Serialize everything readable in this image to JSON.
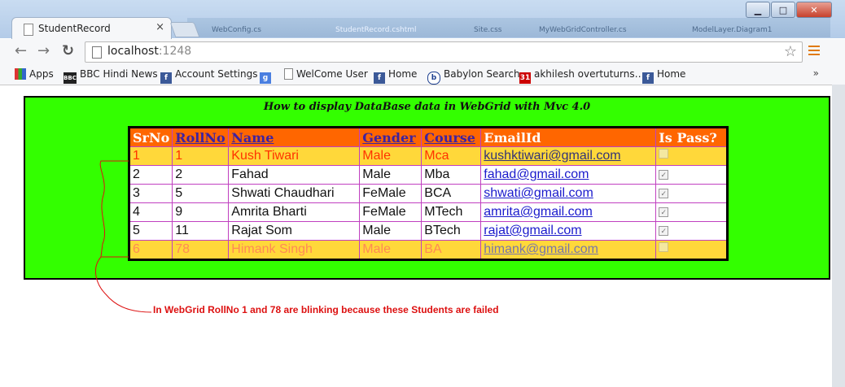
{
  "browser": {
    "tab_title": "StudentRecord",
    "tab_close": "×",
    "url_host": "localhost",
    "url_port": ":1248",
    "window_controls": {
      "minimize": "▁",
      "maximize": "□",
      "close": "✕"
    },
    "background_tabs": [
      "WebConfig.cs",
      "StudentRecord.cshtml",
      "Site.css",
      "MyWebGridController.cs",
      "ModelLayer.Diagram1"
    ]
  },
  "bookmarks": [
    {
      "label": "Apps",
      "icon": "apps-grid-icon"
    },
    {
      "label": "BBC Hindi News",
      "icon": "bbc-icon"
    },
    {
      "label": "Account Settings",
      "icon": "facebook-icon"
    },
    {
      "label": "",
      "icon": "google-icon"
    },
    {
      "label": "WelCome User",
      "icon": "page-icon"
    },
    {
      "label": "Home",
      "icon": "facebook-icon"
    },
    {
      "label": "Babylon Search",
      "icon": "babylon-icon"
    },
    {
      "label": "akhilesh overtuturns…",
      "icon": "news-icon"
    },
    {
      "label": "Home",
      "icon": "facebook-icon"
    }
  ],
  "bookmarks_more": "»",
  "page": {
    "heading": "How to display DataBase data in WebGrid with Mvc 4.0",
    "columns": [
      {
        "label": "SrNo",
        "sortable": false
      },
      {
        "label": "RollNo",
        "sortable": true
      },
      {
        "label": "Name",
        "sortable": true
      },
      {
        "label": "Gender",
        "sortable": true
      },
      {
        "label": "Course",
        "sortable": true
      },
      {
        "label": "EmailId",
        "sortable": false
      },
      {
        "label": "Is Pass?",
        "sortable": false
      }
    ],
    "rows": [
      {
        "srno": "1",
        "rollno": "1",
        "name": "Kush Tiwari",
        "gender": "Male",
        "course": "Mca",
        "email": "kushktiwari@gmail.com",
        "pass": false
      },
      {
        "srno": "2",
        "rollno": "2",
        "name": "Fahad",
        "gender": "Male",
        "course": "Mba",
        "email": "fahad@gmail.com",
        "pass": true
      },
      {
        "srno": "3",
        "rollno": "5",
        "name": "Shwati Chaudhari",
        "gender": "FeMale",
        "course": "BCA",
        "email": "shwati@gmail.com",
        "pass": true
      },
      {
        "srno": "4",
        "rollno": "9",
        "name": "Amrita Bharti",
        "gender": "FeMale",
        "course": "MTech",
        "email": "amrita@gmail.com",
        "pass": true
      },
      {
        "srno": "5",
        "rollno": "11",
        "name": "Rajat Som",
        "gender": "Male",
        "course": "BTech",
        "email": "rajat@gmail.com",
        "pass": true
      },
      {
        "srno": "6",
        "rollno": "78",
        "name": "Himank Singh",
        "gender": "Male",
        "course": "BA",
        "email": "himank@gmail.com",
        "pass": false
      }
    ],
    "annotation": "In WebGrid RollNo 1 and  78 are blinking because these Students are failed"
  },
  "colors": {
    "panel_bg": "#33ff00",
    "header_bg": "#ff6600",
    "failed_row_bg": "#ffd83a",
    "failed_text": "#ff3300",
    "annotation": "#dd1111"
  }
}
